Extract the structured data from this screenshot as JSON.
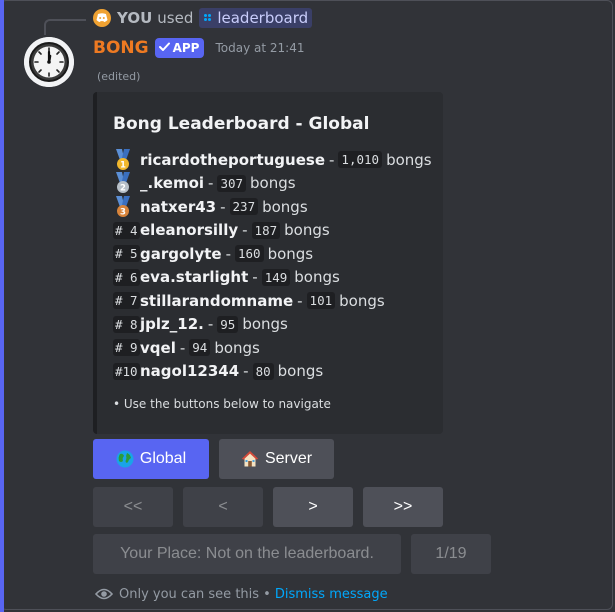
{
  "reply": {
    "user": "YOU",
    "used_text": "used",
    "command": "leaderboard"
  },
  "message": {
    "bot_name": "BONG",
    "app_tag": "APP",
    "timestamp": "Today at 21:41",
    "edited": "(edited)"
  },
  "embed": {
    "title": "Bong Leaderboard - Global",
    "entries": [
      {
        "rank": "",
        "medal": "gold",
        "medal_num": "1",
        "name": "ricardotheportuguese",
        "score": "1,010",
        "unit": "bongs"
      },
      {
        "rank": "",
        "medal": "silver",
        "medal_num": "2",
        "name": "_.kemoi",
        "score": "307",
        "unit": "bongs"
      },
      {
        "rank": "",
        "medal": "bronze",
        "medal_num": "3",
        "name": "natxer43",
        "score": "237",
        "unit": "bongs"
      },
      {
        "rank": "# 4",
        "medal": "",
        "medal_num": "",
        "name": "eleanorsilly",
        "score": "187",
        "unit": "bongs"
      },
      {
        "rank": "# 5",
        "medal": "",
        "medal_num": "",
        "name": "gargolyte",
        "score": "160",
        "unit": "bongs"
      },
      {
        "rank": "# 6",
        "medal": "",
        "medal_num": "",
        "name": "eva.starlight",
        "score": "149",
        "unit": "bongs"
      },
      {
        "rank": "# 7",
        "medal": "",
        "medal_num": "",
        "name": "stillarandomname",
        "score": "101",
        "unit": "bongs"
      },
      {
        "rank": "# 8",
        "medal": "",
        "medal_num": "",
        "name": "jplz_12.",
        "score": "95",
        "unit": "bongs"
      },
      {
        "rank": "# 9",
        "medal": "",
        "medal_num": "",
        "name": "vqel",
        "score": "94",
        "unit": "bongs"
      },
      {
        "rank": "#10",
        "medal": "",
        "medal_num": "",
        "name": "nagol12344",
        "score": "80",
        "unit": "bongs"
      }
    ],
    "dash": "-",
    "footer": "• Use the buttons below to navigate"
  },
  "buttons": {
    "global": "Global",
    "server": "Server",
    "first": "<<",
    "prev": "<",
    "next": ">",
    "last": ">>",
    "your_place": "Your Place: Not on the leaderboard.",
    "page": "1/19"
  },
  "ephemeral": {
    "notice": "Only you can see this •",
    "dismiss": "Dismiss message"
  },
  "icons": {
    "discord_avatar": "discord-icon",
    "slash_command": "apps-icon",
    "verified": "check-icon",
    "globe": "globe-icon",
    "house": "house-icon",
    "eye": "eye-icon",
    "clock": "clock-avatar"
  },
  "colors": {
    "accent": "#5865f2",
    "bot_name": "#ee7a22",
    "link": "#00a8fc",
    "gold": "#f1b82d",
    "silver": "#b8c0c8",
    "bronze": "#d8843b"
  }
}
